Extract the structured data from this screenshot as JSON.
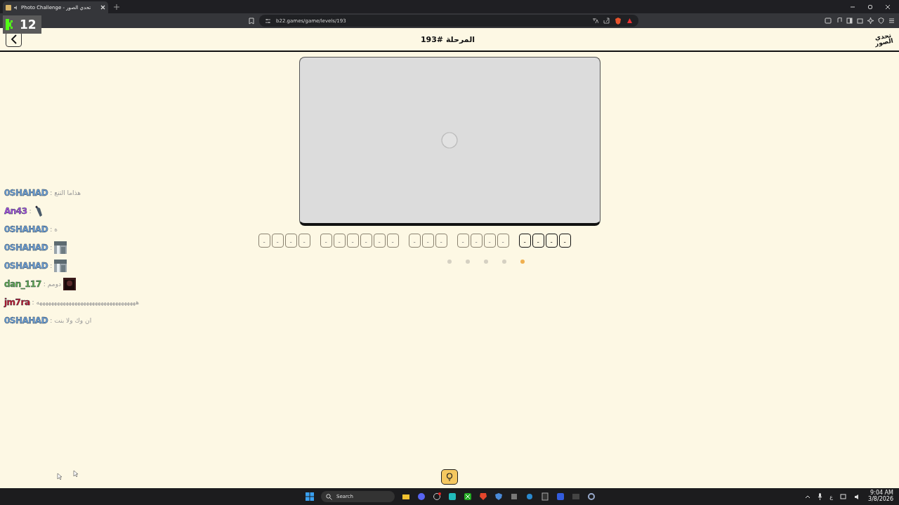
{
  "browser": {
    "tab": {
      "title": "Photo Challenge - تحدي الصور"
    },
    "url": "b22.games/game/levels/193"
  },
  "stream_overlay": {
    "count": "12"
  },
  "header": {
    "title": "المرحلة #193",
    "logo": "تحدي الصور"
  },
  "photo": {
    "loading": true
  },
  "words": [
    {
      "slots": [
        "-",
        "-",
        "-",
        "-"
      ],
      "active": true
    },
    {
      "slots": [
        "-",
        "-",
        "-",
        "-"
      ],
      "active": false
    },
    {
      "slots": [
        "-",
        "-",
        "-"
      ],
      "active": false
    },
    {
      "slots": [
        "-",
        "-",
        "-",
        "-",
        "-",
        "-"
      ],
      "active": false
    },
    {
      "slots": [
        "-",
        "-",
        "-",
        "-"
      ],
      "active": false
    }
  ],
  "pages": [
    {
      "selected": false
    },
    {
      "selected": false
    },
    {
      "selected": false
    },
    {
      "selected": false
    },
    {
      "selected": true
    }
  ],
  "chat": [
    {
      "user": "0SHAHAD",
      "color": "#6a9fd8",
      "separator": ":",
      "kind": "text",
      "text": "هذاما التنع"
    },
    {
      "user": "An43",
      "color": "#a64ce0",
      "separator": ":",
      "kind": "emote"
    },
    {
      "user": "0SHAHAD",
      "color": "#6a9fd8",
      "separator": ":",
      "kind": "text",
      "text": "ه"
    },
    {
      "user": "0SHAHAD",
      "color": "#6a9fd8",
      "separator": ":",
      "kind": "emote"
    },
    {
      "user": "0SHAHAD",
      "color": "#6a9fd8",
      "separator": ":",
      "kind": "emote"
    },
    {
      "user": "dan_117",
      "color": "#5fae4a",
      "separator": ":",
      "kind": "text_emote",
      "text": "دومم"
    },
    {
      "user": "jm7ra",
      "color": "#c0142a",
      "separator": ":",
      "kind": "text",
      "text": "ههههههههههههههههههههههههههههههههههه"
    },
    {
      "user": "0SHAHAD",
      "color": "#6a9fd8",
      "separator": ":",
      "kind": "text",
      "text": "ان وك ولا بنت"
    }
  ],
  "taskbar": {
    "search": {
      "placeholder": "Search"
    },
    "language": "ع",
    "time": "9:04 AM",
    "date": "3/8/2026"
  }
}
